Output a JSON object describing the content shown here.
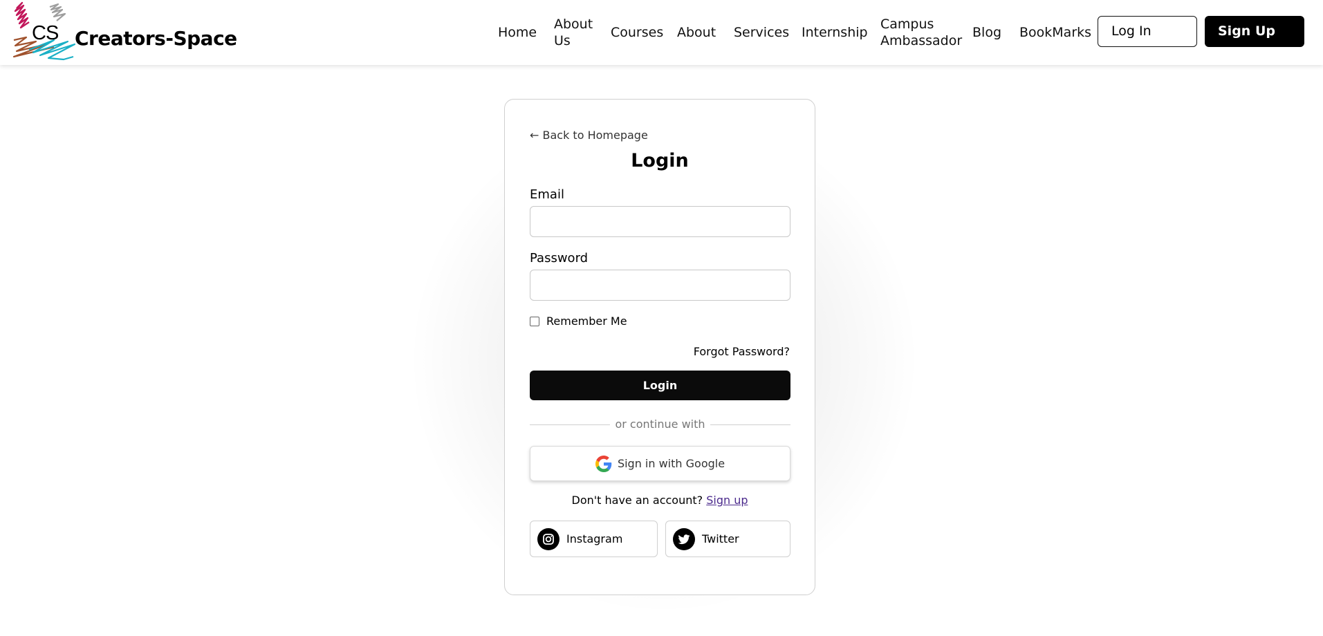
{
  "header": {
    "logo_text": "CS",
    "brand": "Creators-Space",
    "nav": [
      "Home",
      "About Us",
      "Courses",
      "About",
      "Services",
      "Internship",
      "Campus Ambassador",
      "Blog",
      "BookMarks"
    ],
    "login_label": "Log In",
    "signup_label": "Sign Up"
  },
  "form": {
    "back_link": "← Back to Homepage",
    "title": "Login",
    "email_label": "Email",
    "email_value": "",
    "password_label": "Password",
    "password_value": "",
    "remember_label": "Remember Me",
    "remember_checked": false,
    "forgot_label": "Forgot Password?",
    "submit_label": "Login",
    "divider_text": "or continue with",
    "google_label": "Sign in with Google",
    "no_account_text": "Don't have an account?",
    "signup_link": "Sign up",
    "social": [
      {
        "label": "Instagram",
        "icon": "instagram-icon"
      },
      {
        "label": "Twitter",
        "icon": "twitter-icon"
      }
    ]
  },
  "colors": {
    "primary_button": "#0b0b0b",
    "link": "#4b2a8c",
    "logo_pink": "#c2185b",
    "logo_gray": "#9e9e9e",
    "logo_brown": "#a0522d",
    "logo_cyan": "#1ab0c6"
  }
}
